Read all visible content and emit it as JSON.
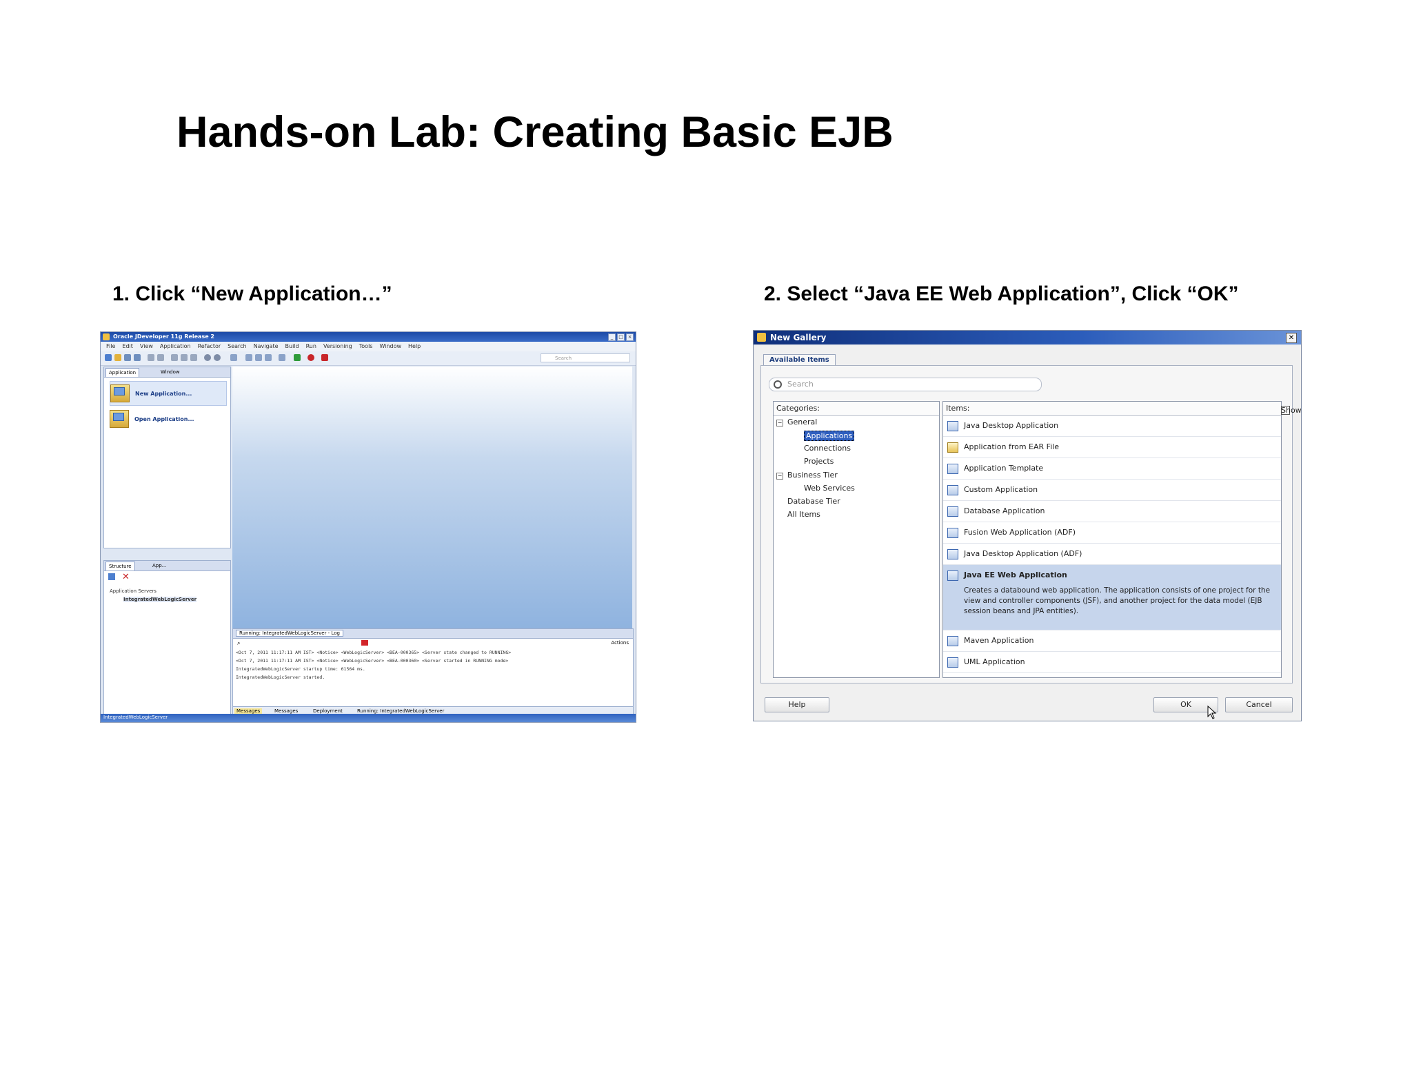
{
  "slide": {
    "title": "Hands-on Lab: Creating Basic EJB",
    "step1": "1. Click “New Application…”",
    "step2": "2. Select “Java EE Web Application”, Click “OK”"
  },
  "ide": {
    "window_title": "Oracle JDeveloper 11g Release 2",
    "menu": [
      "File",
      "Edit",
      "View",
      "Application",
      "Refactor",
      "Search",
      "Navigate",
      "Build",
      "Run",
      "Versioning",
      "Tools",
      "Window",
      "Help"
    ],
    "search_placeholder": "Search",
    "left_tabs": [
      "Application",
      "Window"
    ],
    "actions": [
      {
        "label": "New Application...",
        "icon": "new-application-icon"
      },
      {
        "label": "Open Application...",
        "icon": "open-application-icon"
      }
    ],
    "struct_tabs": [
      "Structure",
      "App..."
    ],
    "tree": [
      "Application Servers",
      "IntegratedWebLogicServer"
    ],
    "log_tab": "Running: IntegratedWebLogicServer - Log",
    "log_actions": "Actions",
    "log_lines": [
      "<Oct 7, 2011 11:17:11 AM IST> <Notice> <WebLogicServer> <BEA-000365> <Server state changed to RUNNING>",
      "<Oct 7, 2011 11:17:11 AM IST> <Notice> <WebLogicServer> <BEA-000360> <Server started in RUNNING mode>",
      "IntegratedWebLogicServer startup time: 61564 ms.",
      "IntegratedWebLogicServer started."
    ],
    "bottom_tabs": [
      "Messages",
      "Messages",
      "Deployment",
      "Running: IntegratedWebLogicServer"
    ],
    "status": "IntegratedWebLogicServer"
  },
  "dialog": {
    "title": "New Gallery",
    "tab": "Available Items",
    "search_placeholder": "Search",
    "categories_label": "Categories:",
    "items_label": "Items:",
    "show_descriptions": "Show All Descriptions",
    "categories": [
      {
        "label": "General",
        "level": 0,
        "expander": "−"
      },
      {
        "label": "Applications",
        "level": 2,
        "selected": true
      },
      {
        "label": "Connections",
        "level": 2
      },
      {
        "label": "Projects",
        "level": 2
      },
      {
        "label": "Business Tier",
        "level": 0,
        "expander": "−"
      },
      {
        "label": "Web Services",
        "level": 2
      },
      {
        "label": "Database Tier",
        "level": 1
      },
      {
        "label": "All Items",
        "level": 1
      }
    ],
    "items": [
      {
        "label": "Java Desktop Application"
      },
      {
        "label": "Application from EAR File"
      },
      {
        "label": "Application Template"
      },
      {
        "label": "Custom Application"
      },
      {
        "label": "Database Application"
      },
      {
        "label": "Fusion Web Application (ADF)"
      },
      {
        "label": "Java Desktop Application (ADF)"
      },
      {
        "label": "Java EE Web Application",
        "selected": true,
        "description": "Creates a databound web application. The application consists of one project for the view and controller components (JSF), and another project for the data model (EJB session beans and JPA entities)."
      },
      {
        "label": "Maven Application"
      },
      {
        "label": "UML Application"
      }
    ],
    "buttons": {
      "help": "Help",
      "ok": "OK",
      "cancel": "Cancel"
    }
  }
}
